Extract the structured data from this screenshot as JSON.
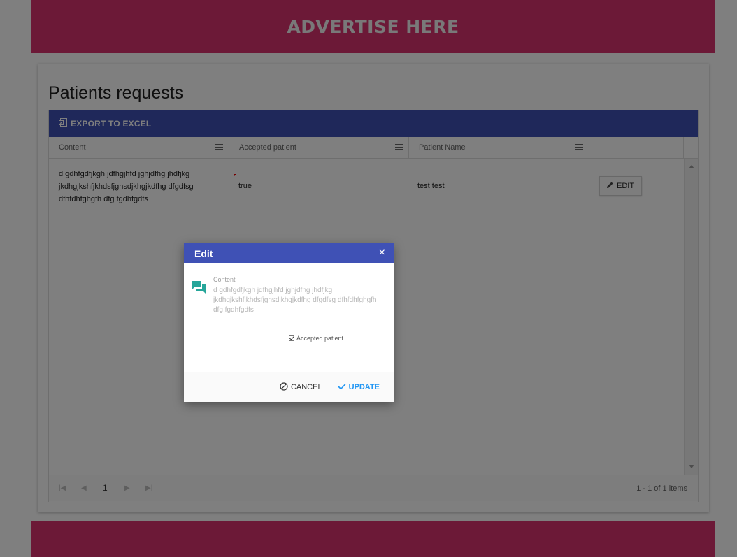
{
  "ad": {
    "top_text": "ADVERTISE HERE"
  },
  "page": {
    "title": "Patients requests"
  },
  "toolbar": {
    "export_label": "EXPORT TO EXCEL"
  },
  "grid": {
    "columns": [
      "Content",
      "Accepted patient",
      "Patient Name"
    ],
    "rows": [
      {
        "content": "d gdhfgdfjkgh jdfhgjhfd jghjdfhg jhdfjkg jkdhgjkshfjkhdsfjghsdjkhgjkdfhg dfgdfsg dfhfdhfghgfh dfg fgdhfgdfs",
        "accepted": "true",
        "name": "test test",
        "edit_label": "EDIT"
      }
    ],
    "pager": {
      "page": "1",
      "info": "1 - 1 of 1 items"
    }
  },
  "dialog": {
    "title": "Edit",
    "close": "×",
    "content_label": "Content",
    "content_value": "d gdhfgdfjkgh jdfhgjhfd jghjdfhg jhdfjkg jkdhgjkshfjkhdsfjghsdjkhgjkdfhg dfgdfsg dfhfdhfghgfh dfg fgdhfgdfs",
    "accepted_label": "Accepted patient",
    "accepted_checked": true,
    "cancel_label": "CANCEL",
    "update_label": "UPDATE"
  },
  "icons": {
    "export": "excel-icon",
    "menu": "column-menu-icon",
    "edit": "pencil-icon",
    "chat": "chat-icon",
    "cancel": "cancel-circle-icon",
    "update": "check-icon"
  },
  "colors": {
    "ad_banner": "#d8336f",
    "primary": "#3f51b5",
    "chat_icon": "#26a69a",
    "update_text": "#2196f3"
  }
}
